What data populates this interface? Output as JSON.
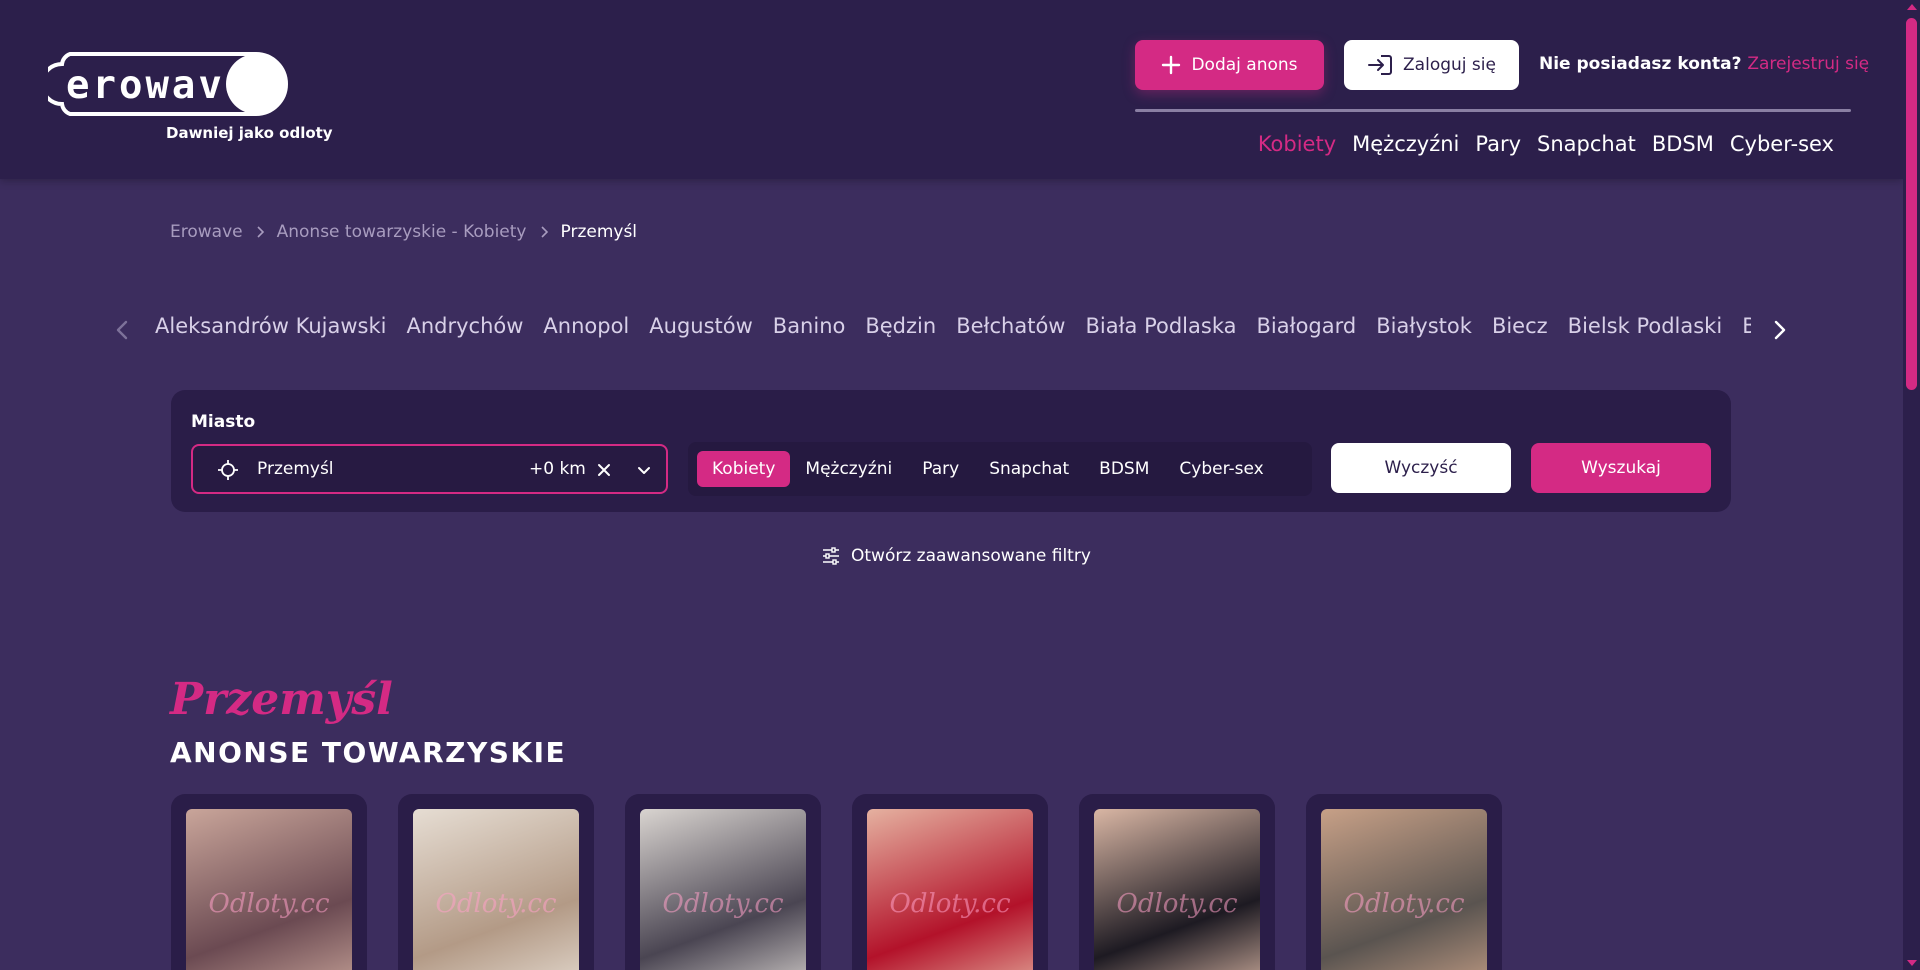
{
  "header": {
    "logo_text": "erowave",
    "logo_sub": "Dawniej jako odloty",
    "add_button": "Dodaj anons",
    "login_button": "Zaloguj się",
    "no_account": "Nie posiadasz konta?",
    "register_link": "Zarejestruj się",
    "nav": [
      "Kobiety",
      "Mężczyźni",
      "Pary",
      "Snapchat",
      "BDSM",
      "Cyber-sex"
    ],
    "nav_active": "Kobiety"
  },
  "breadcrumb": [
    "Erowave",
    "Anonse towarzyskie - Kobiety",
    "Przemyśl"
  ],
  "cities": [
    "Aleksandrów Kujawski",
    "Andrychów",
    "Annopol",
    "Augustów",
    "Banino",
    "Będzin",
    "Bełchatów",
    "Biała Podlaska",
    "Białogard",
    "Białystok",
    "Biecz",
    "Bielsk Podlaski",
    "Bielsko-Biała"
  ],
  "search": {
    "city_label": "Miasto",
    "city_value": "Przemyśl",
    "radius": "+0 km",
    "categories": [
      "Kobiety",
      "Mężczyźni",
      "Pary",
      "Snapchat",
      "BDSM",
      "Cyber-sex"
    ],
    "category_active": "Kobiety",
    "clear_button": "Wyczyść",
    "search_button": "Wyszukaj",
    "advanced_filters": "Otwórz zaawansowane filtry"
  },
  "section": {
    "script_title": "Przemyśl",
    "title": "ANONSE TOWARZYSKIE"
  },
  "cards": [
    {
      "watermark": "Odloty.cc",
      "tone": [
        "#6b4a52",
        "#c9a59a"
      ]
    },
    {
      "watermark": "Odloty.cc",
      "tone": [
        "#b39a86",
        "#e6ddd3"
      ]
    },
    {
      "watermark": "Odloty.cc",
      "tone": [
        "#4a4552",
        "#d9d4d0"
      ]
    },
    {
      "watermark": "Odloty.cc",
      "tone": [
        "#b3122a",
        "#e5b1a0"
      ]
    },
    {
      "watermark": "Odloty.cc",
      "tone": [
        "#1d1a22",
        "#d9b6a4"
      ]
    },
    {
      "watermark": "Odloty.cc",
      "tone": [
        "#5a5450",
        "#c7a087"
      ]
    }
  ],
  "colors": {
    "accent": "#d42a84",
    "background": "#3c2d5e",
    "header": "#2c1f4b",
    "panel": "#2a1d48"
  }
}
